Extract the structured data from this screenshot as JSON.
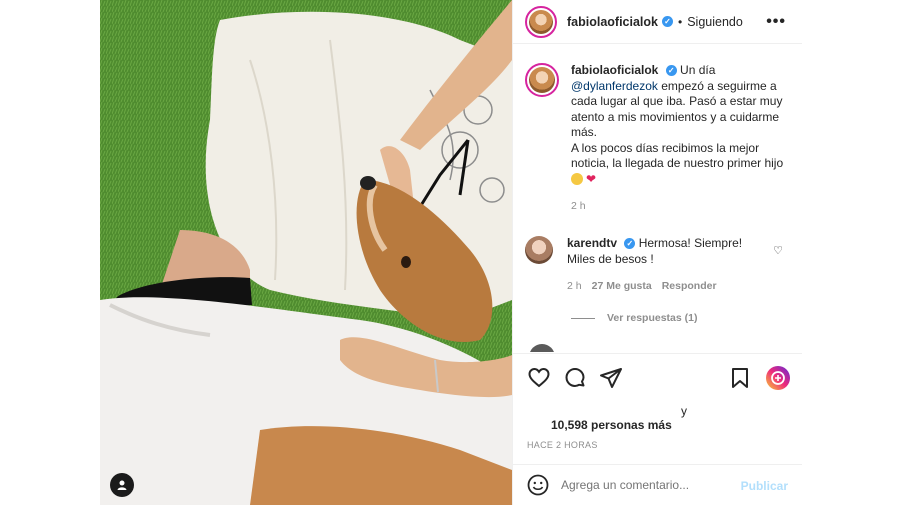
{
  "post": {
    "username": "fabiolaoficialok",
    "separator": "•",
    "follow_status": "Siguiendo",
    "more_icon": "more-horizontal-icon"
  },
  "caption": {
    "username": "fabiolaoficialok",
    "text_1": "Un día",
    "mention": "@dylanferdezok",
    "text_2": "empezó a seguirme a cada lugar al que iba. Pasó a estar muy atento a mis movimientos y a cuidarme más.",
    "text_3": "A los pocos días recibimos la mejor noticia, la llegada de nuestro primer hijo",
    "time": "2 h"
  },
  "comment": {
    "username": "karendtv",
    "text_1": "Hermosa! Siempre!",
    "text_2": "Miles de besos !",
    "time": "2 h",
    "likes": "27 Me gusta",
    "reply_label": "Responder",
    "view_replies": "Ver respuestas (1)"
  },
  "actions": {
    "likes_connector": "y",
    "likes_count": "10,598 personas más",
    "time_ago": "HACE 2 HORAS"
  },
  "add_comment": {
    "placeholder": "Agrega un comentario...",
    "publish_label": "Publicar"
  },
  "colors": {
    "verified": "#3897f0",
    "link": "#00376b",
    "secondary_text": "#8e8e8e",
    "publish_disabled": "#b2dffc"
  }
}
